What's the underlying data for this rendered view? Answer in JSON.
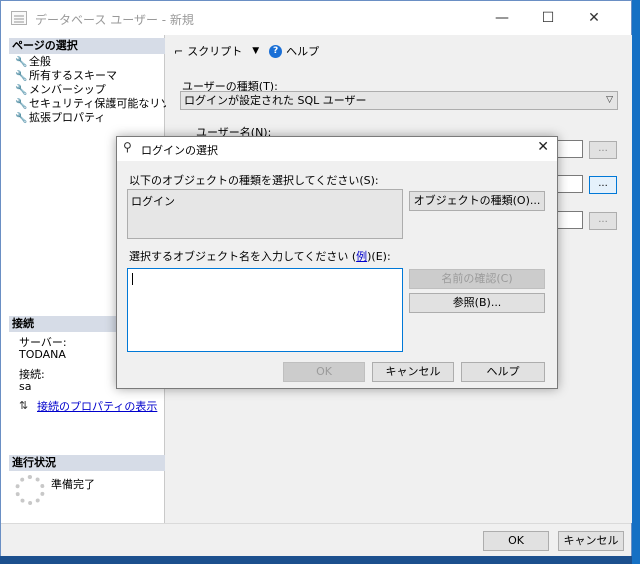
{
  "window": {
    "title": "データベース ユーザー - 新規",
    "controls": {
      "minimize": "—",
      "maximize": "☐",
      "close": "✕"
    }
  },
  "left": {
    "select_page_header": "ページの選択",
    "pages": [
      "全般",
      "所有するスキーマ",
      "メンバーシップ",
      "セキュリティ保護可能なリソース",
      "拡張プロパティ"
    ],
    "connection_header": "接続",
    "server_label": "サーバー:",
    "server_value": "TODANA",
    "connection_label": "接続:",
    "connection_value": "sa",
    "connection_props_link": "接続のプロパティの表示",
    "progress_header": "進行状況",
    "progress_status": "準備完了"
  },
  "right": {
    "toolbar": {
      "script_label": "スクリプト",
      "help_label": "ヘルプ"
    },
    "user_type_label": "ユーザーの種類(T):",
    "user_type_value": "ログインが設定された SQL ユーザー",
    "username_label": "ユーザー名(N):",
    "browse_button": "..."
  },
  "bottom": {
    "ok_label": "OK",
    "cancel_label": "キャンセル"
  },
  "dialog": {
    "title": "ログインの選択",
    "object_type_prompt": "以下のオブジェクトの種類を選択してください(S):",
    "object_type_value": "ログイン",
    "object_types_button": "オブジェクトの種類(O)...",
    "enter_names_prompt": "選択するオブジェクト名を入力してください",
    "enter_names_paren_open": "(",
    "examples_link": "例",
    "enter_names_suffix": ")(E):",
    "check_names_button": "名前の確認(C)",
    "browse_button": "参照(B)...",
    "ok_button": "OK",
    "cancel_button": "キャンセル",
    "help_button": "ヘルプ",
    "close": "✕"
  }
}
